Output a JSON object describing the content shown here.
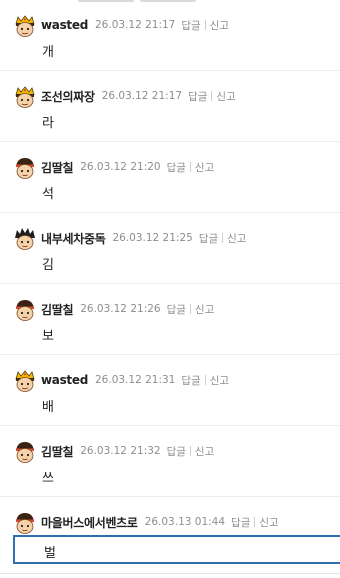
{
  "actions": {
    "reply": "답글",
    "report": "신고"
  },
  "comments": [
    {
      "author": "wasted",
      "date": "26.03.12 21:17",
      "text": "개",
      "avatar": "crown-king-avatar-icon"
    },
    {
      "author": "조선의짜장",
      "date": "26.03.12 21:17",
      "text": "라",
      "avatar": "crown-king-avatar-icon"
    },
    {
      "author": "김딸칠",
      "date": "26.03.12 21:20",
      "text": "석",
      "avatar": "headband-boy-avatar-icon"
    },
    {
      "author": "내부세차중독",
      "date": "26.03.12 21:25",
      "text": "김",
      "avatar": "spiky-hair-avatar-icon"
    },
    {
      "author": "김딸칠",
      "date": "26.03.12 21:26",
      "text": "보",
      "avatar": "headband-boy-avatar-icon"
    },
    {
      "author": "wasted",
      "date": "26.03.12 21:31",
      "text": "배",
      "avatar": "crown-king-avatar-icon"
    },
    {
      "author": "김딸칠",
      "date": "26.03.12 21:32",
      "text": "쓰",
      "avatar": "headband-boy-avatar-icon"
    },
    {
      "author": "마을버스에서벤츠로",
      "date": "26.03.13 01:44",
      "text": "벌",
      "avatar": "headband-boy-avatar-icon"
    }
  ],
  "colors": {
    "author": "#222222",
    "meta": "#8e8e8e",
    "active_border": "#2f6fad",
    "divider": "#ececec"
  }
}
